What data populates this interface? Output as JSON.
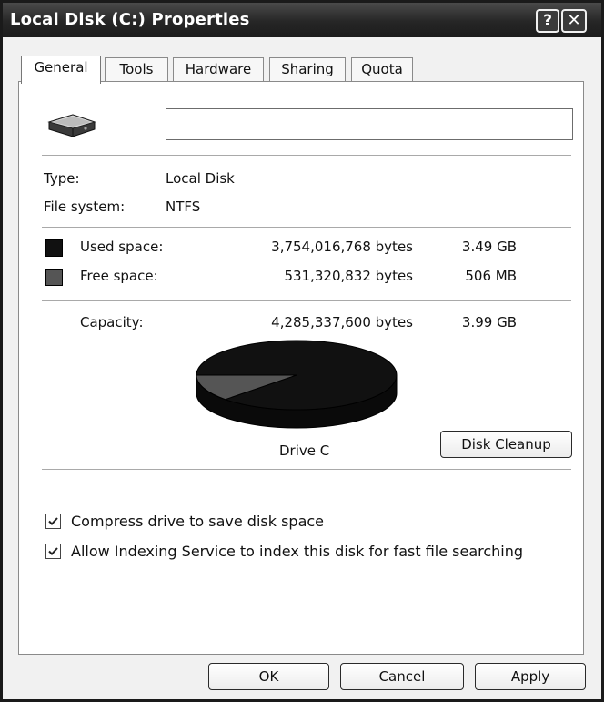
{
  "window": {
    "title": "Local Disk (C:) Properties",
    "help_label": "?",
    "close_label": "✕"
  },
  "tabs": [
    {
      "label": "General",
      "active": true
    },
    {
      "label": "Tools",
      "active": false
    },
    {
      "label": "Hardware",
      "active": false
    },
    {
      "label": "Sharing",
      "active": false
    },
    {
      "label": "Quota",
      "active": false
    }
  ],
  "general": {
    "drive_icon": "hard-drive-icon",
    "name_field": {
      "value": ""
    },
    "type_label": "Type:",
    "type_value": "Local Disk",
    "fs_label": "File system:",
    "fs_value": "NTFS",
    "used": {
      "label": "Used space:",
      "bytes": "3,754,016,768 bytes",
      "size": "3.49 GB",
      "color": "#111111"
    },
    "free": {
      "label": "Free space:",
      "bytes": "531,320,832 bytes",
      "size": "506 MB",
      "color": "#555555"
    },
    "capacity": {
      "label": "Capacity:",
      "bytes": "4,285,337,600 bytes",
      "size": "3.99 GB"
    },
    "pie": {
      "used_bytes": 3754016768,
      "free_bytes": 531320832
    },
    "drive_label": "Drive C",
    "cleanup_button": "Disk Cleanup",
    "options": [
      {
        "label": "Compress drive to save disk space",
        "checked": true
      },
      {
        "label": "Allow Indexing Service to index this disk for fast file searching",
        "checked": true
      }
    ]
  },
  "footer": {
    "ok": "OK",
    "cancel": "Cancel",
    "apply": "Apply"
  }
}
